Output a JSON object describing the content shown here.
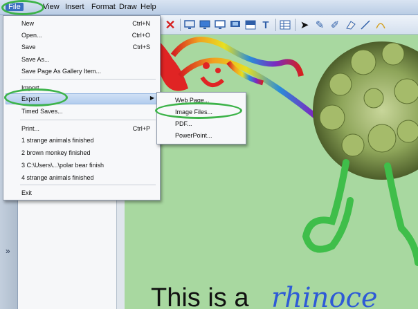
{
  "menubar": {
    "items": [
      "File",
      "View",
      "Insert",
      "Format",
      "Draw",
      "Help"
    ]
  },
  "file_menu": {
    "items": [
      {
        "label": "New",
        "shortcut": "Ctrl+N"
      },
      {
        "label": "Open...",
        "shortcut": "Ctrl+O"
      },
      {
        "label": "Save",
        "shortcut": "Ctrl+S"
      },
      {
        "label": "Save As...",
        "shortcut": ""
      },
      {
        "label": "Save Page As Gallery Item...",
        "shortcut": ""
      },
      {
        "label": "Import",
        "shortcut": ""
      },
      {
        "label": "Export",
        "shortcut": ""
      },
      {
        "label": "Timed Saves...",
        "shortcut": ""
      },
      {
        "label": "Print...",
        "shortcut": "Ctrl+P"
      },
      {
        "label": "1 strange animals finished",
        "shortcut": ""
      },
      {
        "label": "2 brown monkey finished",
        "shortcut": ""
      },
      {
        "label": "3 C:\\Users\\...\\polar bear finish",
        "shortcut": ""
      },
      {
        "label": "4 strange animals finished",
        "shortcut": ""
      },
      {
        "label": "Exit",
        "shortcut": ""
      }
    ]
  },
  "export_submenu": {
    "items": [
      "Web Page...",
      "Image Files...",
      "PDF...",
      "PowerPoint..."
    ]
  },
  "left_panel": {
    "collapse_glyph": "»"
  },
  "canvas": {
    "caption": "This is a",
    "handwriting": "rhinoce"
  },
  "colors": {
    "highlight_ring": "#3db34a",
    "canvas_bg": "#a8d8a0",
    "handwriting": "#2e5bd6"
  },
  "icons": [
    "delete-x-icon",
    "display-icon",
    "monitor-icon",
    "screen-icon",
    "screen-blue-icon",
    "shade-icon",
    "text-icon",
    "table-icon",
    "select-arrow-icon",
    "pen-icon",
    "highlighter-icon",
    "eraser-icon",
    "line-icon",
    "shape-icon"
  ]
}
